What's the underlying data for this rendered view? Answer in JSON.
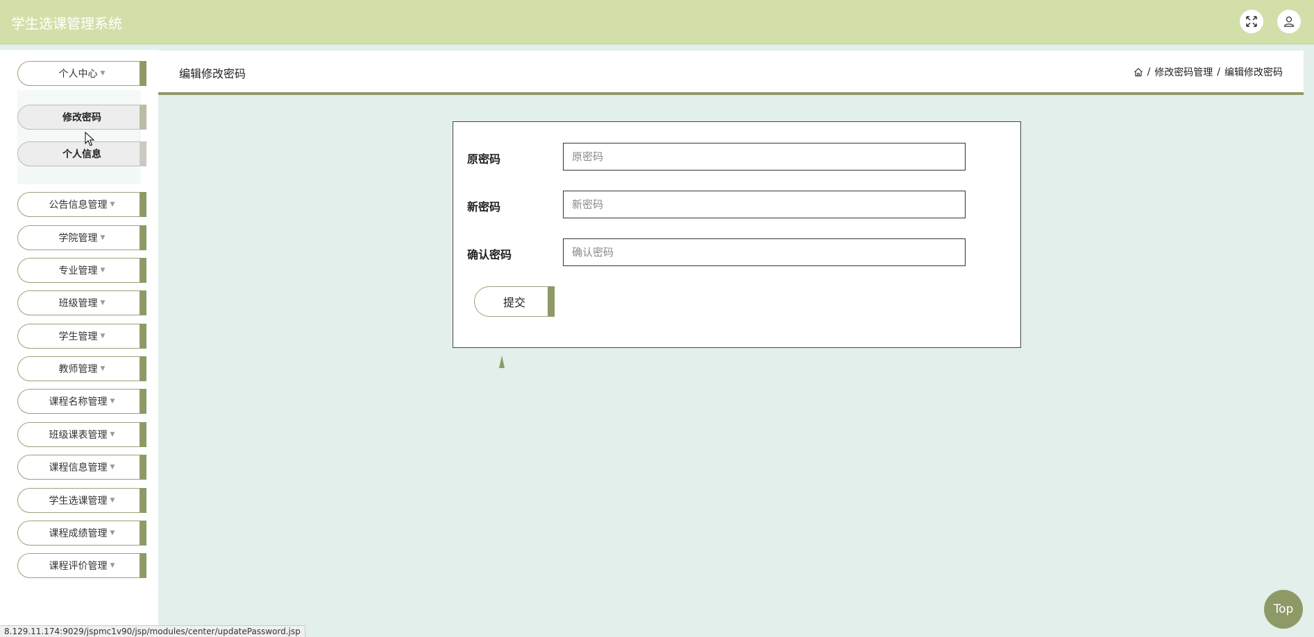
{
  "app": {
    "title": "学生选课管理系统"
  },
  "topbar": {
    "fullscreen_icon": "expand-icon",
    "user_icon": "user-icon"
  },
  "sidebar": {
    "personal_center": "个人中心",
    "submenu": [
      {
        "label": "修改密码",
        "active": true
      },
      {
        "label": "个人信息",
        "active": false
      }
    ],
    "items": [
      {
        "label": "公告信息管理"
      },
      {
        "label": "学院管理"
      },
      {
        "label": "专业管理"
      },
      {
        "label": "班级管理"
      },
      {
        "label": "学生管理"
      },
      {
        "label": "教师管理"
      },
      {
        "label": "课程名称管理"
      },
      {
        "label": "班级课表管理"
      },
      {
        "label": "课程信息管理"
      },
      {
        "label": "学生选课管理"
      },
      {
        "label": "课程成绩管理"
      },
      {
        "label": "课程评价管理"
      }
    ]
  },
  "header": {
    "title": "编辑修改密码",
    "breadcrumb": {
      "sep": "/",
      "level1": "修改密码管理",
      "level2": "编辑修改密码"
    }
  },
  "form": {
    "old_password": {
      "label": "原密码",
      "placeholder": "原密码"
    },
    "new_password": {
      "label": "新密码",
      "placeholder": "新密码"
    },
    "confirm_password": {
      "label": "确认密码",
      "placeholder": "确认密码"
    },
    "submit_label": "提交"
  },
  "top_button": "Top",
  "status_url": "8.129.11.174:9029/jspmc1v90/jsp/modules/center/updatePassword.jsp",
  "colors": {
    "accent": "#8e9a66",
    "topbar": "#d3dfa8",
    "background": "#e2efeb"
  }
}
